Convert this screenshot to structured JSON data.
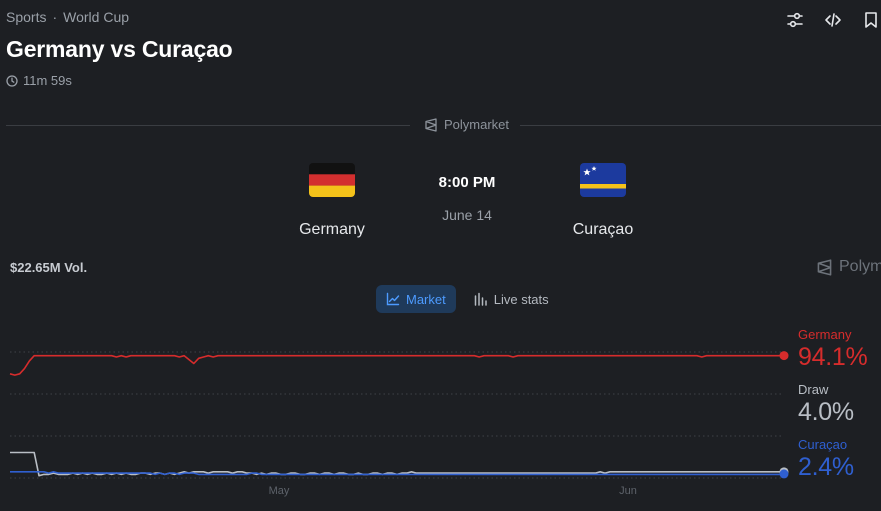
{
  "breadcrumb": {
    "section": "Sports",
    "separator": "·",
    "category": "World Cup"
  },
  "title": "Germany vs Curaçao",
  "timer": "11m 59s",
  "source": "Polymarket",
  "match": {
    "home": {
      "name": "Germany",
      "flag": "germany-flag"
    },
    "away": {
      "name": "Curaçao",
      "flag": "curacao-flag"
    },
    "time": "8:00 PM",
    "date": "June 14"
  },
  "volume": "$22.65M Vol.",
  "tabs": {
    "market": "Market",
    "live_stats": "Live stats"
  },
  "icons": [
    "sliders-icon",
    "code-icon",
    "bookmark-icon",
    "clock-icon",
    "polymarket-icon",
    "line-chart-icon",
    "bar-chart-icon"
  ],
  "colors": {
    "germany": "#d62c2c",
    "draw": "#b9bec5",
    "curacao": "#2f5fd0",
    "active_tab": "#4d9bff",
    "background": "#1d1f23"
  },
  "legend": [
    {
      "name": "Germany",
      "value": "94.1%",
      "color": "#d62c2c"
    },
    {
      "name": "Draw",
      "value": "4.0%",
      "color": "#b9bec5"
    },
    {
      "name": "Curaçao",
      "value": "2.4%",
      "color": "#2f5fd0"
    }
  ],
  "chart_data": {
    "type": "line",
    "x_ticks": [
      "May",
      "Jun"
    ],
    "ylim": [
      0,
      100
    ],
    "grid": true,
    "legend_placement": "right",
    "series": [
      {
        "name": "Germany",
        "color": "#d62c2c",
        "values": [
          80,
          79,
          80,
          84,
          90,
          94,
          94,
          94,
          94,
          94,
          94,
          94,
          94,
          94,
          94,
          94,
          94,
          94,
          94,
          94,
          94,
          94,
          93,
          94,
          93,
          94,
          94,
          94,
          94,
          94,
          94,
          94,
          94,
          94,
          94,
          93,
          94,
          91,
          88,
          92,
          93,
          94,
          93,
          94,
          94,
          94,
          94,
          94,
          94,
          94,
          94,
          94,
          94,
          94,
          94,
          94,
          94,
          94,
          94,
          94,
          94,
          94,
          94,
          94,
          94,
          94,
          94,
          94,
          94,
          94,
          94,
          94,
          94,
          94,
          94,
          94,
          94,
          94,
          94,
          94,
          94,
          94,
          94,
          94,
          94,
          94,
          94,
          94,
          94,
          94,
          94,
          94,
          94,
          94,
          94,
          94,
          94,
          93,
          94,
          94,
          94,
          94,
          94,
          94,
          93,
          94,
          94,
          94,
          94,
          94,
          94,
          94,
          94,
          94,
          94,
          94,
          94,
          94,
          94,
          94,
          94,
          94,
          94,
          94,
          94,
          94,
          94,
          94,
          94,
          94,
          94,
          94,
          94,
          94,
          94,
          94,
          94,
          94,
          94,
          94,
          94,
          94,
          94,
          93,
          94,
          94,
          94,
          94,
          94,
          94,
          94,
          94,
          94,
          94,
          94,
          94,
          94,
          94,
          94,
          94,
          94.1
        ]
      },
      {
        "name": "Draw",
        "color": "#b9bec5",
        "values": [
          19,
          19,
          19,
          19,
          19,
          19,
          1,
          2,
          2,
          3,
          2,
          2,
          2,
          3,
          2,
          3,
          2,
          3,
          2,
          2,
          3,
          2,
          3,
          2,
          3,
          2,
          2,
          3,
          3,
          2,
          3,
          3,
          2,
          3,
          2,
          3,
          4,
          3,
          4,
          4,
          4,
          3,
          4,
          4,
          4,
          4,
          3,
          4,
          4,
          3,
          3,
          2,
          3,
          2,
          3,
          3,
          2,
          2,
          3,
          3,
          2,
          2,
          3,
          3,
          2,
          3,
          3,
          2,
          3,
          3,
          2,
          2,
          3,
          2,
          2,
          3,
          3,
          2,
          3,
          3,
          2,
          3,
          3,
          4,
          3,
          3,
          3,
          3,
          3,
          3,
          3,
          3,
          3,
          3,
          3,
          3,
          3,
          3,
          3,
          3,
          3,
          3,
          3,
          3,
          3,
          3,
          3,
          3,
          3,
          3,
          3,
          3,
          3,
          3,
          3,
          3,
          3,
          3,
          3,
          3,
          3,
          3,
          4,
          3,
          4,
          4,
          4,
          4,
          4,
          4,
          4,
          4,
          4,
          4,
          4,
          4,
          4,
          4,
          4,
          4,
          4,
          4,
          4,
          4,
          4,
          4,
          4,
          4,
          4,
          4,
          4,
          4,
          4,
          4,
          4,
          4,
          4,
          4,
          4,
          4,
          4.0
        ]
      },
      {
        "name": "Curaçao",
        "color": "#2f5fd0",
        "values": [
          4,
          4,
          4,
          4,
          4,
          4,
          4,
          4,
          3,
          4,
          3,
          3,
          3,
          3,
          3,
          3,
          3,
          3,
          3,
          3,
          3,
          3,
          3,
          3,
          3,
          3,
          3,
          3,
          3,
          3,
          2,
          3,
          2,
          3,
          3,
          2,
          3,
          3,
          3,
          2,
          2,
          2,
          2,
          2,
          2,
          2,
          2,
          2,
          2,
          2,
          3,
          3,
          2,
          2,
          2,
          2,
          2,
          2,
          2,
          2,
          2,
          2,
          2,
          2,
          2,
          2,
          2,
          2,
          2,
          2,
          2,
          2,
          2,
          2,
          2,
          2,
          2,
          2,
          2,
          2,
          2,
          2,
          2,
          2,
          2,
          2,
          2,
          2,
          2,
          2,
          2,
          2,
          2,
          2,
          2,
          2,
          2,
          2,
          2,
          2,
          2,
          2,
          2,
          2,
          2,
          2,
          2,
          2,
          2,
          2,
          2,
          2,
          2,
          2,
          2,
          2,
          2,
          2,
          2,
          2,
          2,
          2,
          2,
          2,
          2,
          2,
          2,
          2,
          2,
          2,
          2,
          2,
          2,
          2,
          2,
          2,
          2,
          2,
          2,
          2,
          2,
          2,
          2,
          2,
          2,
          2,
          2,
          2,
          2,
          2,
          2,
          2,
          2,
          2,
          2,
          2,
          2,
          2,
          2,
          2,
          2.4
        ]
      }
    ]
  }
}
